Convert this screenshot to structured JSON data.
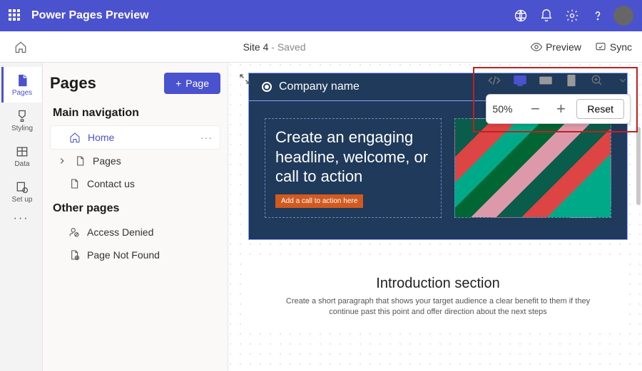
{
  "header": {
    "title": "Power Pages Preview"
  },
  "subheader": {
    "site_name": "Site 4",
    "state": " - Saved",
    "preview": "Preview",
    "sync": "Sync"
  },
  "rail": {
    "items": [
      {
        "label": "Pages"
      },
      {
        "label": "Styling"
      },
      {
        "label": "Data"
      },
      {
        "label": "Set up"
      }
    ]
  },
  "panel": {
    "heading": "Pages",
    "add_label": "Page",
    "section_main": "Main navigation",
    "section_other": "Other pages",
    "main_items": [
      {
        "label": "Home"
      },
      {
        "label": "Pages"
      },
      {
        "label": "Contact us"
      }
    ],
    "other_items": [
      {
        "label": "Access Denied"
      },
      {
        "label": "Page Not Found"
      }
    ]
  },
  "toolbar": {
    "zoom": "50%",
    "reset": "Reset"
  },
  "preview": {
    "company": "Company name",
    "headline": "Create an engaging headline, welcome, or call to action",
    "cta": "Add a call to action here",
    "intro_title": "Introduction section",
    "intro_body": "Create a short paragraph that shows your target audience a clear benefit to them if they continue past this point and offer direction about the next steps"
  }
}
